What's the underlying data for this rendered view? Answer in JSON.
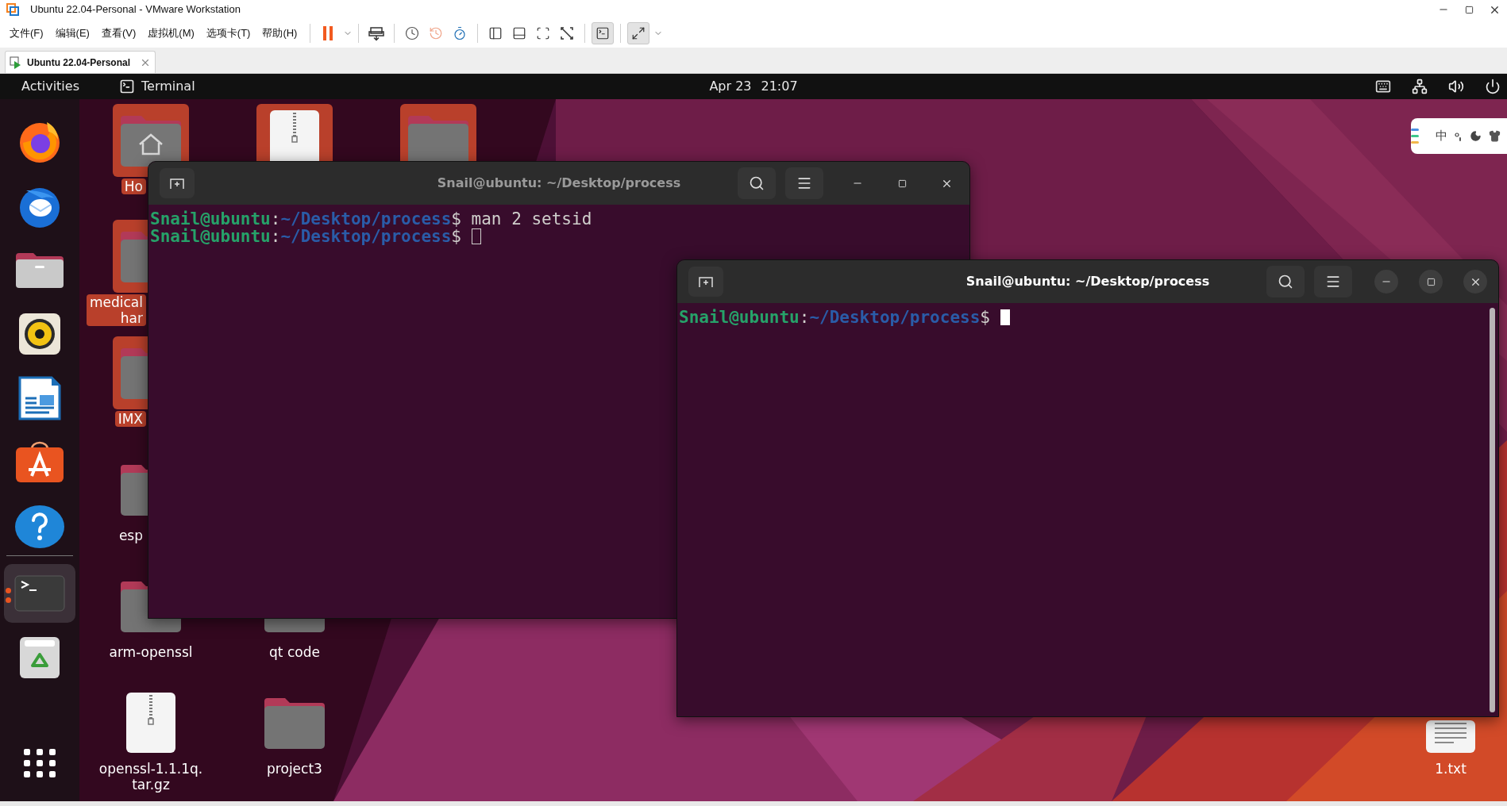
{
  "vm_window": {
    "title": "Ubuntu 22.04-Personal - VMware Workstation"
  },
  "menu": [
    "文件(F)",
    "编辑(E)",
    "查看(V)",
    "虚拟机(M)",
    "选项卡(T)",
    "帮助(H)"
  ],
  "toolbar": [
    {
      "items": [
        {
          "kind": "pause",
          "pressed": false,
          "disabled": false,
          "has_menu": true
        }
      ]
    },
    {
      "items": [
        {
          "kind": "send-keys",
          "pressed": false,
          "disabled": false,
          "has_menu": false
        }
      ]
    },
    {
      "items": [
        {
          "kind": "snapshot",
          "pressed": false,
          "disabled": false,
          "has_menu": false
        },
        {
          "kind": "revert",
          "pressed": false,
          "disabled": true,
          "has_menu": false
        },
        {
          "kind": "snapshot-manager",
          "pressed": false,
          "disabled": false,
          "has_menu": false
        }
      ]
    },
    {
      "items": [
        {
          "kind": "sidebar",
          "pressed": false,
          "disabled": false,
          "has_menu": false
        },
        {
          "kind": "console-view",
          "pressed": false,
          "disabled": false,
          "has_menu": false
        },
        {
          "kind": "fullscreen",
          "pressed": false,
          "disabled": false,
          "has_menu": false
        },
        {
          "kind": "unity",
          "pressed": false,
          "disabled": false,
          "has_menu": false
        }
      ]
    },
    {
      "items": [
        {
          "kind": "terminal",
          "pressed": true,
          "disabled": false,
          "has_menu": false
        }
      ]
    },
    {
      "items": [
        {
          "kind": "stretch",
          "pressed": true,
          "disabled": false,
          "has_menu": true
        }
      ]
    }
  ],
  "vm_tabs": [
    {
      "label": "Ubuntu 22.04-Personal",
      "selected": true
    }
  ],
  "top_bar": {
    "activities": "Activities",
    "app": "Terminal",
    "date": "Apr 23",
    "time": "21:07"
  },
  "dock": [
    {
      "kind": "firefox",
      "running": false
    },
    {
      "kind": "thunderbird",
      "running": false
    },
    {
      "kind": "files",
      "running": false
    },
    {
      "kind": "rhythmbox",
      "running": false
    },
    {
      "kind": "writer",
      "running": false
    },
    {
      "kind": "software",
      "running": false
    },
    {
      "kind": "help",
      "running": false
    },
    {
      "kind": "terminal",
      "running": true
    },
    {
      "kind": "trash",
      "running": false
    },
    {
      "kind": "apps",
      "running": false
    }
  ],
  "desktop_icons": [
    {
      "kind": "home",
      "label": "Ho",
      "selected": true
    },
    {
      "kind": "archive",
      "selected": true
    },
    {
      "kind": "folder",
      "selected": true
    },
    {
      "kind": "folder",
      "label": "medical\nhar",
      "selected": true
    },
    {
      "kind": "folder",
      "label": "IMX",
      "selected": true
    },
    {
      "kind": "folder",
      "label": "esp",
      "selected": false
    },
    {
      "kind": "folder",
      "label": "arm-openssl",
      "selected": false
    },
    {
      "kind": "folder",
      "label": "qt code",
      "selected": false
    },
    {
      "kind": "archive",
      "label": "openssl-1.1.1q.\ntar.gz",
      "selected": false
    },
    {
      "kind": "folder",
      "label": "project3",
      "selected": false
    },
    {
      "kind": "text",
      "label": "1.txt",
      "selected": false
    }
  ],
  "input_method": {
    "mode": "中"
  },
  "terminals": [
    {
      "title": "Snail@ubuntu: ~/Desktop/process",
      "focused": false,
      "scrollbar": false,
      "lines": [
        {
          "user": "Snail@ubuntu",
          "sep": ":",
          "path": "~/Desktop/process",
          "dollar": "$",
          "command": "man 2 setsid",
          "cursor": false
        },
        {
          "user": "Snail@ubuntu",
          "sep": ":",
          "path": "~/Desktop/process",
          "dollar": "$",
          "cursor": true
        }
      ]
    },
    {
      "title": "Snail@ubuntu: ~/Desktop/process",
      "focused": true,
      "scrollbar": true,
      "lines": [
        {
          "user": "Snail@ubuntu",
          "sep": ":",
          "path": "~/Desktop/process",
          "dollar": "$",
          "cursor": true
        }
      ]
    }
  ]
}
